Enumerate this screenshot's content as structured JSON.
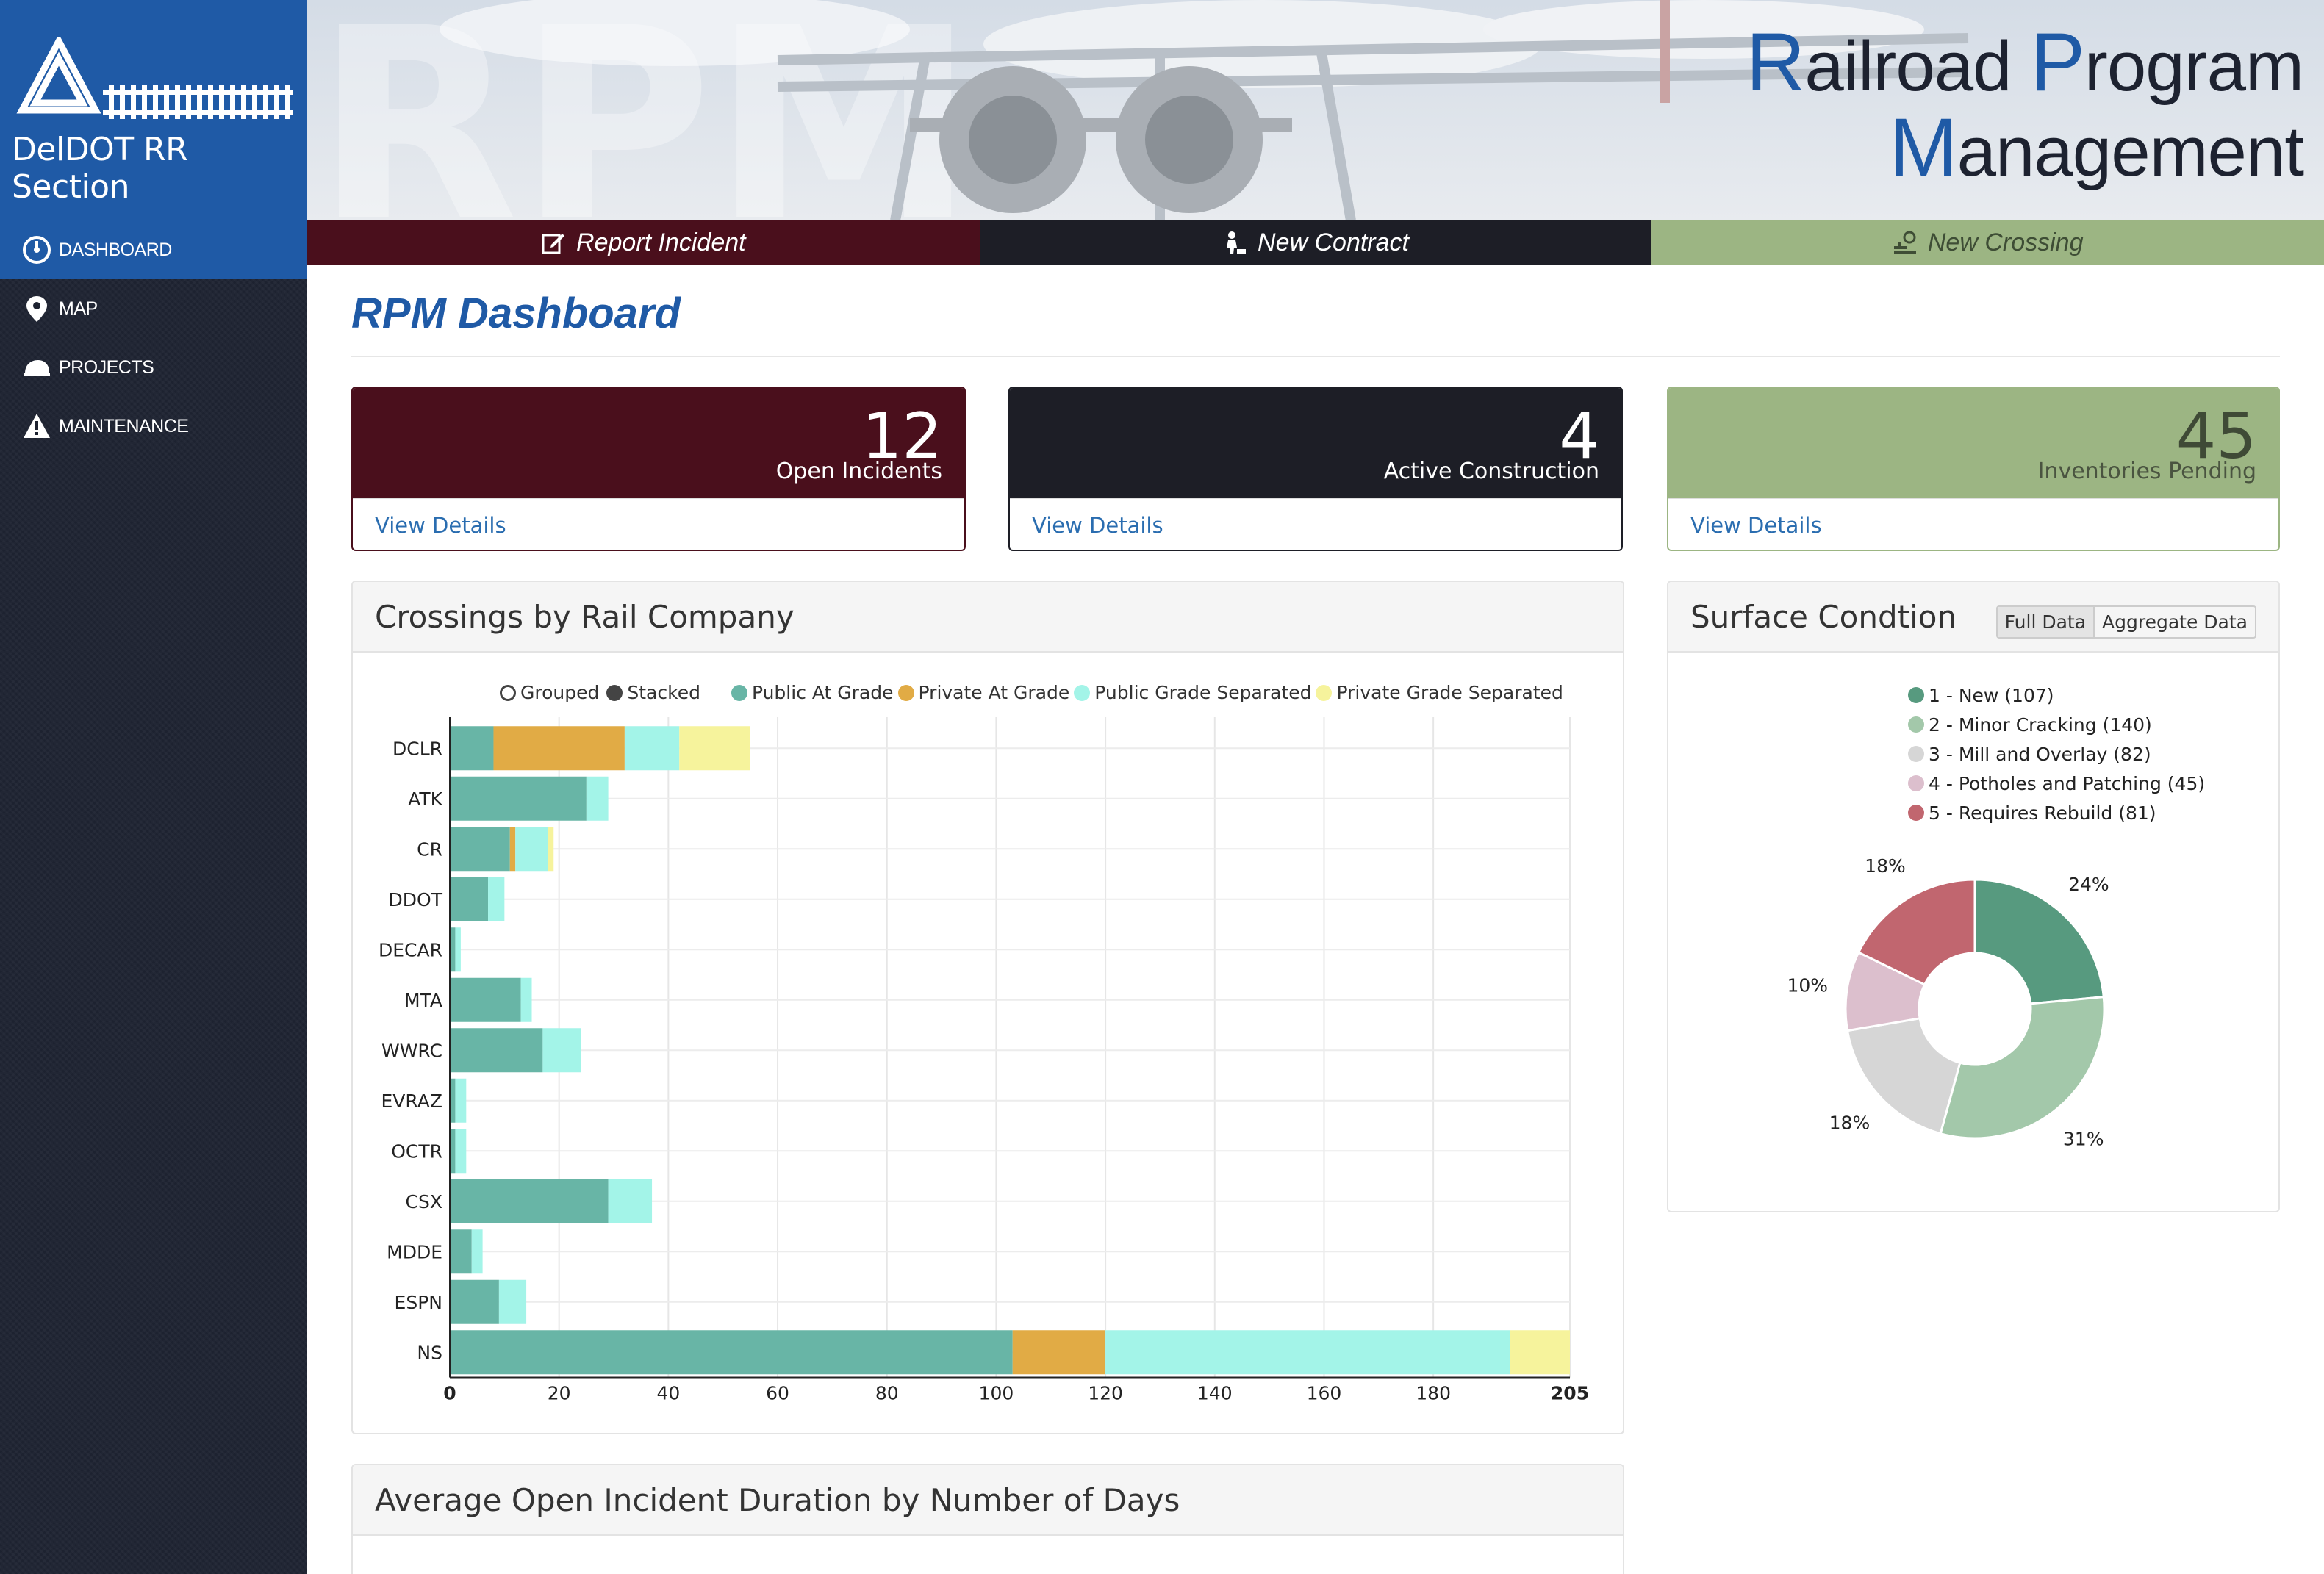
{
  "sidebar": {
    "logo_text": "DelDOT RR Section",
    "items": [
      {
        "label": "DASHBOARD",
        "icon": "dashboard-icon",
        "active": true
      },
      {
        "label": "MAP",
        "icon": "map-pin-icon",
        "active": false
      },
      {
        "label": "PROJECTS",
        "icon": "hardhat-icon",
        "active": false
      },
      {
        "label": "MAINTENANCE",
        "icon": "warning-icon",
        "active": false
      }
    ]
  },
  "banner": {
    "title_line1_cap1": "R",
    "title_line1_rest1": "ailroad ",
    "title_line1_cap2": "P",
    "title_line1_rest2": "rogram",
    "title_line2_cap": "M",
    "title_line2_rest": "anagement",
    "watermark": "RPM"
  },
  "actions": {
    "report_incident": "Report Incident",
    "new_contract": "New Contract",
    "new_crossing": "New Crossing"
  },
  "page_title": "RPM Dashboard",
  "stats": [
    {
      "value": "12",
      "label": "Open Incidents",
      "link": "View Details",
      "color": "#4a0f1c"
    },
    {
      "value": "4",
      "label": "Active Construction",
      "link": "View Details",
      "color": "#1d1e26"
    },
    {
      "value": "45",
      "label": "Inventories Pending",
      "link": "View Details",
      "color": "#9cb583"
    }
  ],
  "crossings_panel": {
    "title": "Crossings by Rail Company",
    "mode_grouped": "Grouped",
    "mode_stacked": "Stacked"
  },
  "surface_panel": {
    "title": "Surface Condtion",
    "toggle_full": "Full Data",
    "toggle_aggregate": "Aggregate Data"
  },
  "duration_panel": {
    "title": "Average Open Incident Duration by Number of Days"
  },
  "chart_data": [
    {
      "type": "bar",
      "orientation": "horizontal",
      "stacked": true,
      "categories": [
        "DCLR",
        "ATK",
        "CR",
        "DDOT",
        "DECAR",
        "MTA",
        "WWRC",
        "EVRAZ",
        "OCTR",
        "CSX",
        "MDDE",
        "ESPN",
        "NS"
      ],
      "series": [
        {
          "name": "Public At Grade",
          "color": "#68b5a6",
          "values": [
            8,
            25,
            11,
            7,
            1,
            13,
            17,
            1,
            1,
            29,
            4,
            9,
            103
          ]
        },
        {
          "name": "Private At Grade",
          "color": "#e1ab45",
          "values": [
            24,
            0,
            1,
            0,
            0,
            0,
            0,
            0,
            0,
            0,
            0,
            0,
            17
          ]
        },
        {
          "name": "Public Grade Separated",
          "color": "#a3f4e8",
          "values": [
            10,
            4,
            6,
            3,
            1,
            2,
            7,
            2,
            2,
            8,
            2,
            5,
            74
          ]
        },
        {
          "name": "Private Grade Separated",
          "color": "#f6f39c",
          "values": [
            13,
            0,
            1,
            0,
            0,
            0,
            0,
            0,
            0,
            0,
            0,
            0,
            11
          ]
        }
      ],
      "xticks": [
        "0",
        "20",
        "40",
        "60",
        "80",
        "100",
        "120",
        "140",
        "160",
        "180",
        "205"
      ],
      "xlim": [
        0,
        205
      ],
      "grid": true,
      "legend": "top"
    },
    {
      "type": "pie",
      "donut": true,
      "labels": [
        "1 - New (107)",
        "2 - Minor Cracking (140)",
        "3 - Mill and Overlay (82)",
        "4 - Potholes and Patching (45)",
        "5 - Requires Rebuild (81)"
      ],
      "values": [
        107,
        140,
        82,
        45,
        81
      ],
      "percent_labels": [
        "24%",
        "31%",
        "18%",
        "10%",
        "18%"
      ],
      "colors": [
        "#579a7f",
        "#a3c8aa",
        "#d6d6d6",
        "#dcbfcd",
        "#c1666f"
      ],
      "legend": "top"
    }
  ]
}
